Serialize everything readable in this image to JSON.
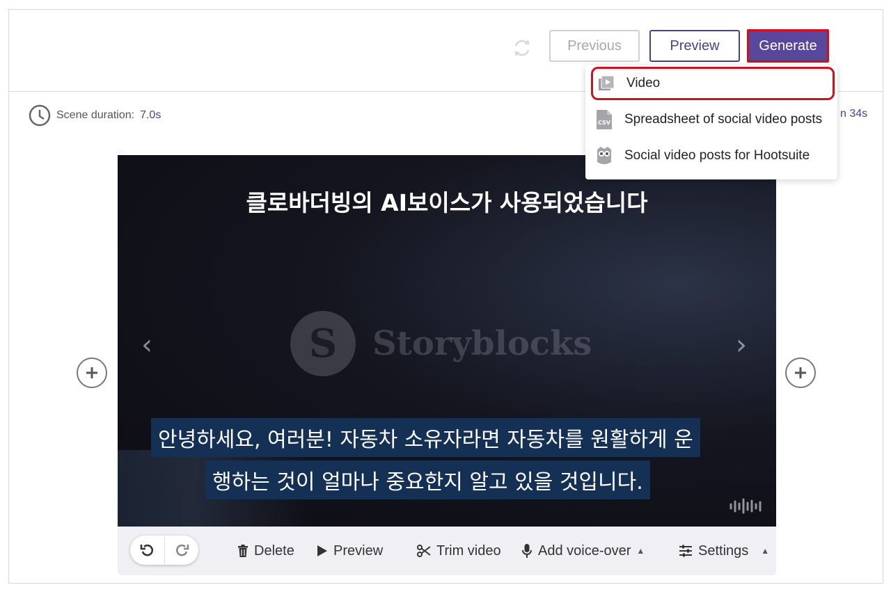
{
  "header": {
    "previous_label": "Previous",
    "preview_label": "Preview",
    "generate_label": "Generate"
  },
  "generate_menu": {
    "items": [
      {
        "label": "Video",
        "icon": "video-play-icon"
      },
      {
        "label": "Spreadsheet of social video posts",
        "icon": "csv-file-icon"
      },
      {
        "label": "Social video posts for Hootsuite",
        "icon": "hootsuite-owl-icon"
      }
    ]
  },
  "scene": {
    "duration_label": "Scene duration:",
    "duration_value": "7.0s",
    "total_partial": "n 34s"
  },
  "video": {
    "title": "클로바더빙의 AI보이스가 사용되었습니다",
    "watermark": "Storyblocks",
    "subtitle_line1": "안녕하세요, 여러분! 자동차 소유자라면 자동차를 원활하게 운",
    "subtitle_line2": "행하는 것이 얼마나 중요한지 알고 있을 것입니다."
  },
  "toolbar": {
    "delete_label": "Delete",
    "preview_label": "Preview",
    "trim_label": "Trim video",
    "voice_label": "Add voice-over",
    "settings_label": "Settings"
  },
  "colors": {
    "accent": "#59479b",
    "highlight": "#d0101a",
    "link": "#4d3f8e",
    "subtitle_bg": "#143055"
  }
}
